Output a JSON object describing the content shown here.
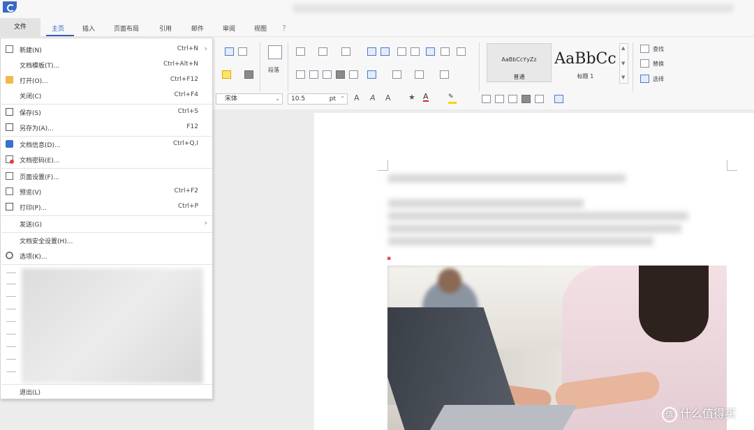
{
  "titlebar": {
    "logo": "wps-logo"
  },
  "tabs": [
    {
      "label": "文件"
    },
    {
      "label": "主页"
    },
    {
      "label": "插入"
    },
    {
      "label": "页面布局"
    },
    {
      "label": "引用"
    },
    {
      "label": "邮件"
    },
    {
      "label": "审阅"
    },
    {
      "label": "视图"
    }
  ],
  "ribbon": {
    "paragraph_label": "段落",
    "font_name": "宋体",
    "font_size": "10.5",
    "font_unit": "pt",
    "style_normal_preview": "AaBbCcYyZz",
    "style_normal_name": "普通",
    "style_heading_preview": "AaBbCc",
    "style_heading_name": "标题 1",
    "find_label": "查找",
    "replace_label": "替换",
    "select_label": "选择"
  },
  "file_menu": {
    "items": [
      {
        "label": "新建(N)",
        "shortcut": "Ctrl+N",
        "icon": "new-doc-icon",
        "has_arrow": true
      },
      {
        "label": "文档模板(T)...",
        "shortcut": "Ctrl+Alt+N",
        "icon": "",
        "has_arrow": false
      },
      {
        "label": "打开(O)...",
        "shortcut": "Ctrl+F12",
        "icon": "folder-icon",
        "has_arrow": false
      },
      {
        "label": "关闭(C)",
        "shortcut": "Ctrl+F4",
        "icon": "",
        "has_arrow": false
      },
      {
        "label": "保存(S)",
        "shortcut": "Ctrl+S",
        "icon": "save-icon",
        "has_arrow": false
      },
      {
        "label": "另存为(A)...",
        "shortcut": "F12",
        "icon": "save-as-icon",
        "has_arrow": false
      },
      {
        "label": "文档信息(D)...",
        "shortcut": "Ctrl+Q,I",
        "icon": "info-icon",
        "has_arrow": false
      },
      {
        "label": "文档密码(E)...",
        "shortcut": "",
        "icon": "doc-password-icon",
        "has_arrow": false
      },
      {
        "label": "页面设置(F)...",
        "shortcut": "",
        "icon": "page-setup-icon",
        "has_arrow": false
      },
      {
        "label": "预览(V)",
        "shortcut": "Ctrl+F2",
        "icon": "preview-icon",
        "has_arrow": false
      },
      {
        "label": "打印(P)...",
        "shortcut": "Ctrl+P",
        "icon": "print-icon",
        "has_arrow": false
      },
      {
        "label": "发送(G)",
        "shortcut": "",
        "icon": "",
        "has_arrow": true
      },
      {
        "label": "文档安全设置(H)...",
        "shortcut": "",
        "icon": "",
        "has_arrow": false
      },
      {
        "label": "选项(K)...",
        "shortcut": "",
        "icon": "gear-icon",
        "has_arrow": false
      },
      {
        "label": "退出(L)",
        "shortcut": "",
        "icon": "",
        "has_arrow": false
      }
    ]
  },
  "watermark": {
    "text": "什么值得买",
    "icon_glyph": "值"
  },
  "colors": {
    "accent": "#2f5fbf",
    "menu_bg": "#ffffff",
    "ribbon_bg": "#f7f7f7"
  }
}
